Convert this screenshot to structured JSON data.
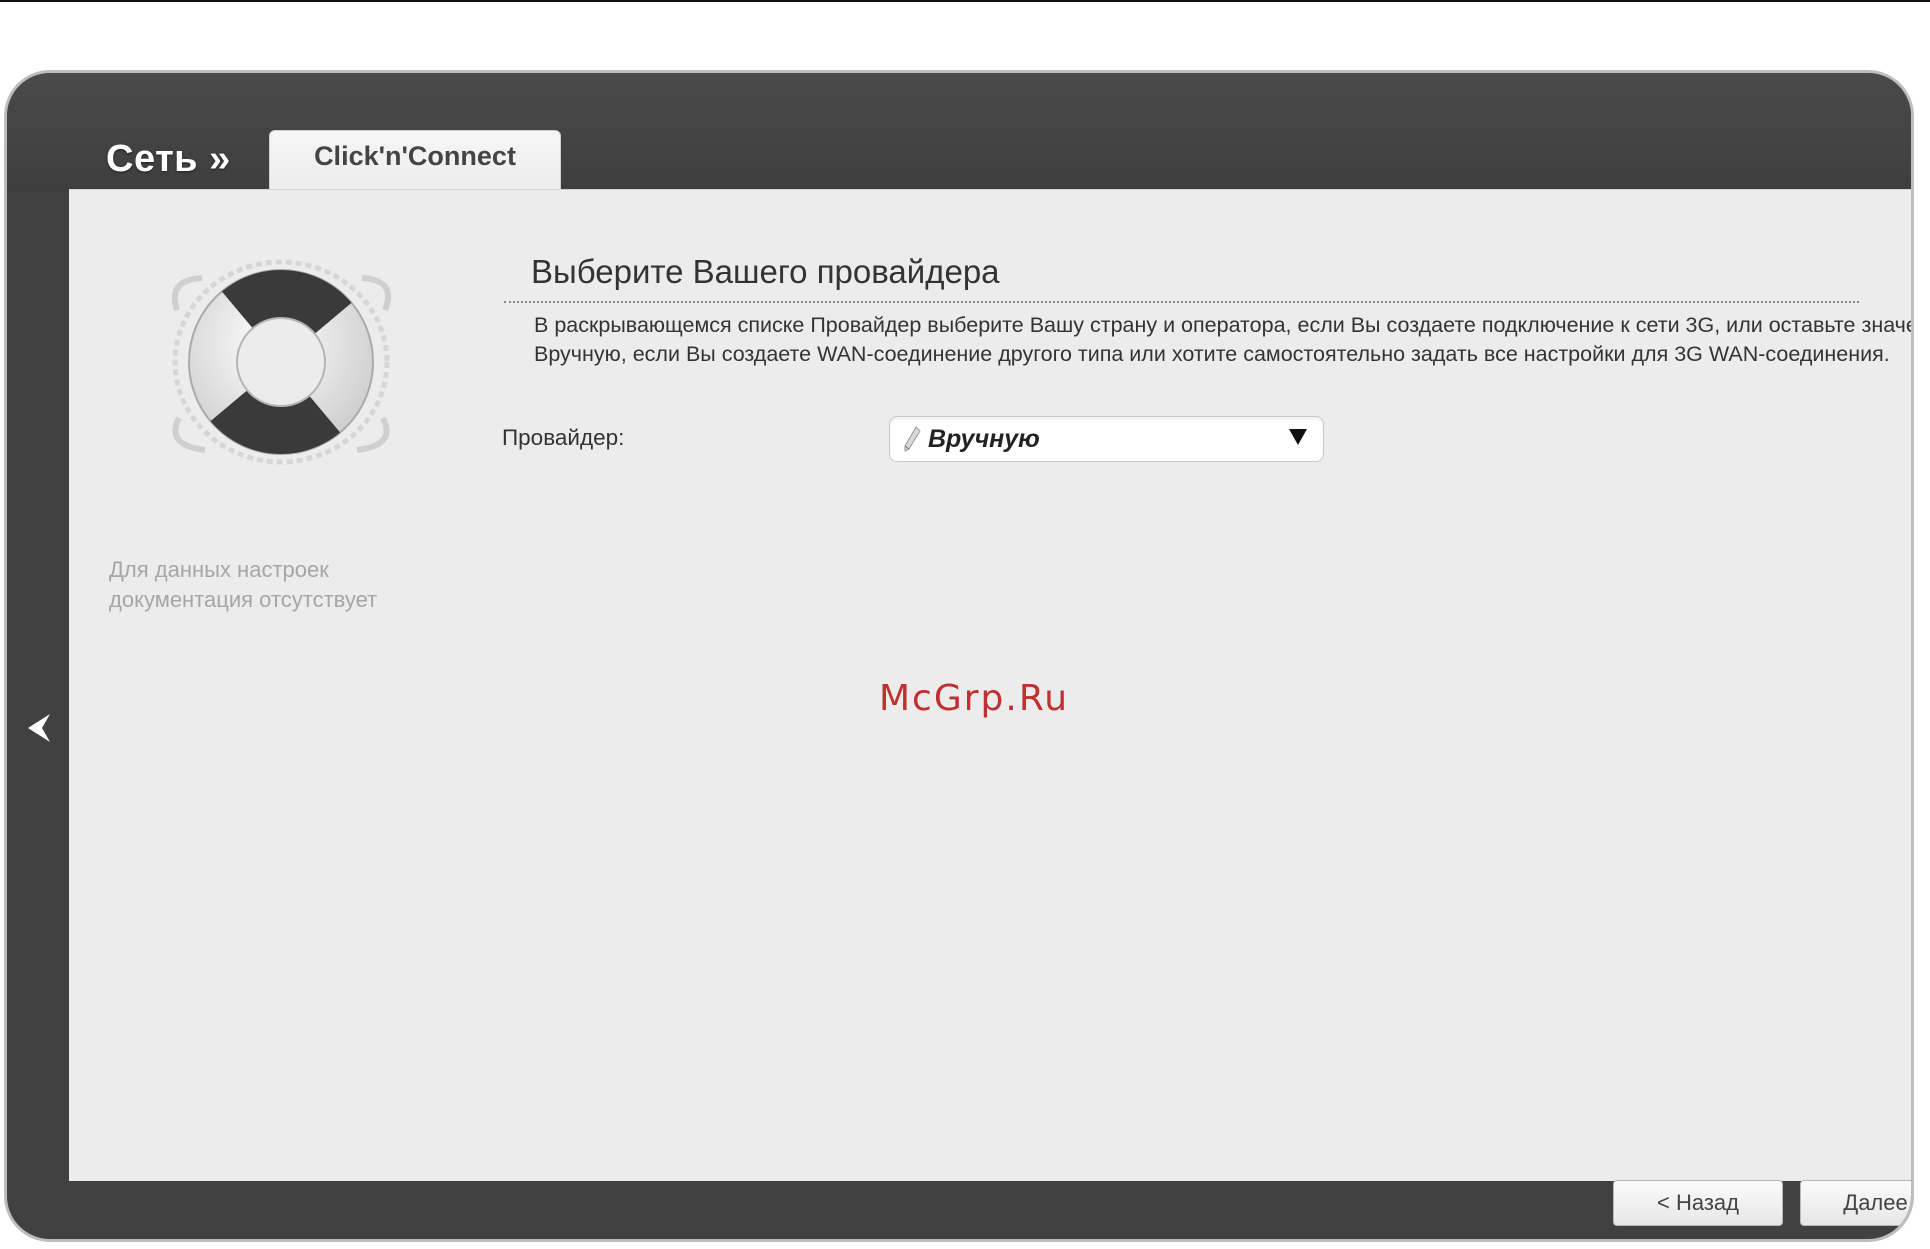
{
  "header": {
    "section_title": "Сеть »",
    "tab_label": "Click'n'Connect"
  },
  "sidebar": {
    "icon": "lifebuoy-icon",
    "help_note": "Для данных настроек документация отсутствует",
    "collapse_icon": "chevron-left-icon"
  },
  "main": {
    "heading": "Выберите Вашего провайдера",
    "description": "В раскрывающемся списке Провайдер выберите Вашу страну и оператора, если Вы создаете подключение к сети 3G, или оставьте значение Вручную, если Вы создаете WAN-соединение другого типа или хотите самостоятельно задать все настройки для 3G WAN-соединения.",
    "provider_label": "Провайдер:",
    "provider_value": "Вручную"
  },
  "watermark": "McGrp.Ru",
  "footer": {
    "back_label": "< Назад",
    "next_label": "Далее >"
  },
  "colors": {
    "frame": "#414141",
    "panel": "#ececec",
    "watermark": "#c03030"
  }
}
